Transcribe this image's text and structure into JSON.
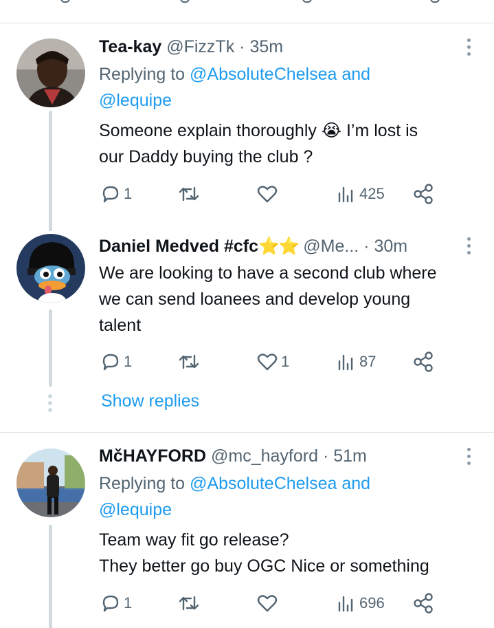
{
  "tweets": [
    {
      "name": "Tea-kay",
      "handle": "@FizzTk",
      "time": "35m",
      "replying_prefix": "Replying to ",
      "replying_line1": "@AbsoluteChelsea and",
      "replying_line2": "@lequipe",
      "text_line1": "Someone explain thoroughly 😭 I’m lost is",
      "text_line2": "our Daddy buying the club ?",
      "replies": "1",
      "retweets": "",
      "likes": "",
      "views": "425"
    },
    {
      "name": "Daniel Medved #cfc",
      "stars": "⭐⭐",
      "handle": "@Me...",
      "time": "30m",
      "text_line1": "We are looking to have a second club where",
      "text_line2": "we can send loanees and develop young",
      "text_line3": "talent",
      "replies": "1",
      "retweets": "",
      "likes": "1",
      "views": "87"
    },
    {
      "name": "MčHAYFORD",
      "handle": "@mc_hayford",
      "time": "51m",
      "replying_prefix": "Replying to ",
      "replying_line1": "@AbsoluteChelsea and",
      "replying_line2": "@lequipe",
      "text_line1": "Team way fit go release?",
      "text_line2": "They better go buy OGC Nice or something",
      "replies": "1",
      "retweets": "",
      "likes": "",
      "views": "696"
    }
  ],
  "show_replies": "Show replies",
  "dot_separator": "·",
  "colors": {
    "link": "#1d9bf0",
    "secondary": "#536471",
    "thread": "#cfd9de",
    "star": "#f5b400"
  },
  "icons": [
    "reply-icon",
    "retweet-icon",
    "like-icon",
    "views-icon",
    "share-icon",
    "more-icon"
  ]
}
